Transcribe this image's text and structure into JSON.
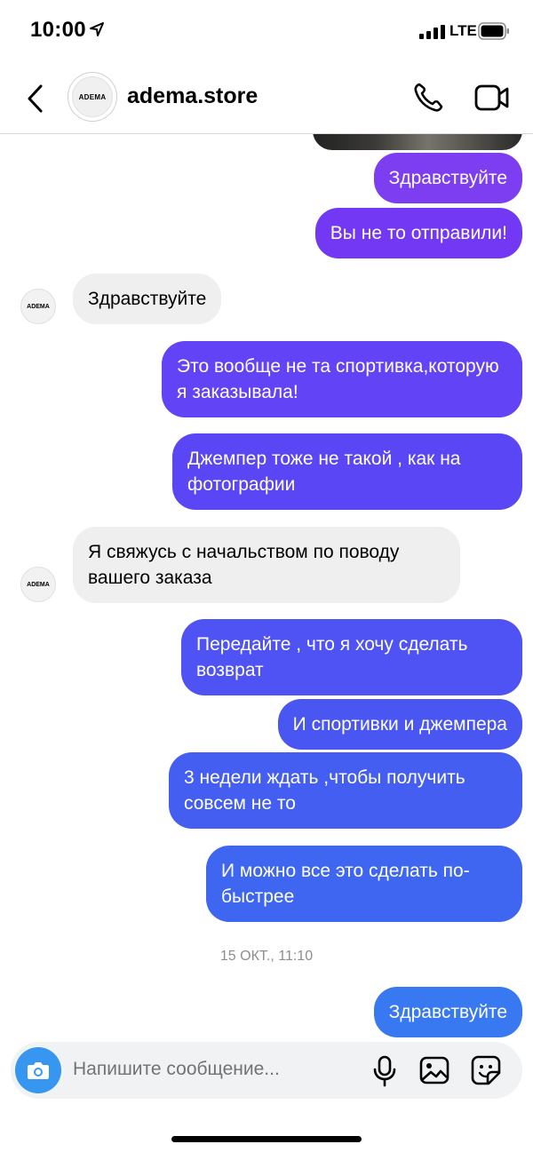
{
  "status_bar": {
    "time": "10:00",
    "network": "LTE"
  },
  "header": {
    "username": "adema.store",
    "avatar_text": "ADEMA"
  },
  "messages": [
    {
      "side": "out",
      "text": "Здравствуйте",
      "color": "#7d3df0"
    },
    {
      "side": "out",
      "text": "Вы не то отправили!",
      "color": "#7338f4"
    },
    {
      "side": "in",
      "text": "Здравствуйте"
    },
    {
      "side": "out",
      "text": "Это вообще не та спортивка,которую я заказывала!",
      "color": "#6243f6"
    },
    {
      "side": "out",
      "text": "Джемпер тоже не такой , как на фотографии",
      "color": "#5a46f5"
    },
    {
      "side": "in",
      "text": "Я свяжусь с начальством по поводу вашего заказа"
    },
    {
      "side": "out",
      "text": "Передайте , что я хочу сделать возврат",
      "color": "#4f53f3"
    },
    {
      "side": "out",
      "text": "И спортивки и джемпера",
      "color": "#4a56f2"
    },
    {
      "side": "out",
      "text": "3 недели ждать ,чтобы получить совсем не то",
      "color": "#455ef2"
    },
    {
      "side": "out",
      "text": "И можно все это сделать по-быстрее",
      "color": "#3f66f1"
    },
    {
      "side": "out",
      "text": "Здравствуйте",
      "color": "#3878f0"
    }
  ],
  "timestamp": "15 ОКТ., 11:10",
  "composer": {
    "placeholder": "Напишите сообщение..."
  },
  "colors": {
    "accent": "#3797f0",
    "incoming_bubble": "#efefef"
  }
}
